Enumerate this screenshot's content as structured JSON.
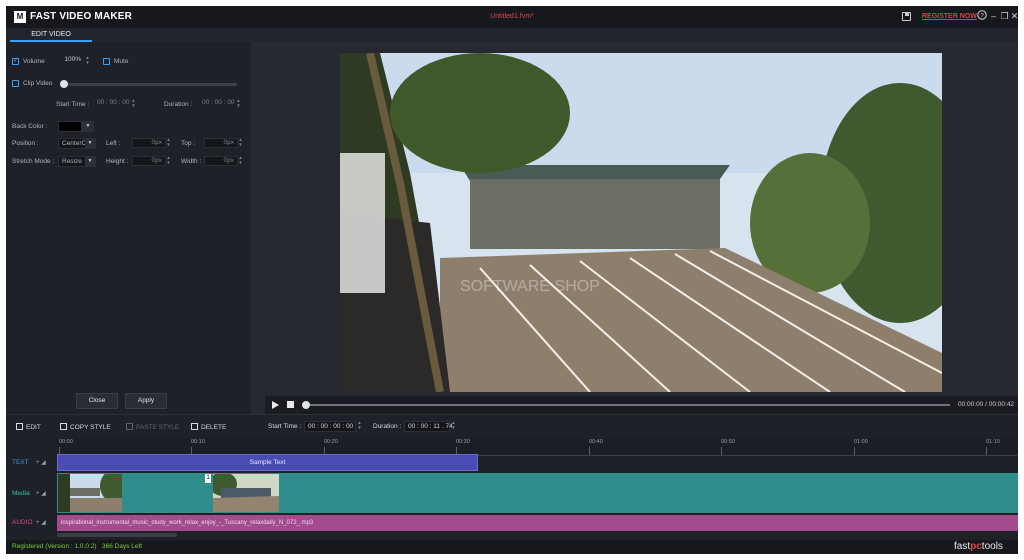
{
  "window": {
    "app_title": "FAST VIDEO MAKER",
    "logo_text": "M",
    "doc_title": "Untitled1.fvm*",
    "register_link": "REGISTER NOW",
    "help_icon": "help-icon",
    "controls": [
      "–",
      "❐",
      "✕"
    ]
  },
  "tabs": {
    "edit_video": "EDIT VIDEO"
  },
  "panel": {
    "volume_label": "Volume",
    "volume_value": "100%",
    "volume_checked": true,
    "mute_label": "Mute",
    "mute_checked": false,
    "clip_video_label": "Clip Video",
    "clip_video_checked": false,
    "start_time_label": "Start Time :",
    "start_time_value": "00 : 00 : 00",
    "duration_label": "Duration :",
    "duration_value": "00 : 00 : 00",
    "back_color_label": "Back Color :",
    "back_color": "#000000",
    "position_label": "Position :",
    "position_value": "CenterCe",
    "left_label": "Left :",
    "left_value": "0px",
    "top_label": "Top :",
    "top_value": "0px",
    "stretch_label": "Stretch Mode :",
    "stretch_value": "Resize",
    "height_label": "Height :",
    "height_value": "0px",
    "width_label": "Width :",
    "width_value": "0px",
    "close_button": "Close",
    "apply_button": "Apply"
  },
  "player": {
    "watermark": "SOFTWARE SHOP",
    "current_time": "00:00:00",
    "separator": "/",
    "total_time": "00:00:42",
    "progress": 0
  },
  "toolbar": {
    "edit": "EDIT",
    "copy_style": "COPY STYLE",
    "paste_style": "PASTE STYLE",
    "delete": "DELETE",
    "start_time_label": "Start Time :",
    "start_time_value": "00 : 00 : 00 : 00",
    "duration_label": "Duration :",
    "duration_value": "00 : 00 : 11 . 74"
  },
  "timeline": {
    "ruler": [
      "00:00",
      "00:10",
      "00:20",
      "00:30",
      "00:40",
      "00:50",
      "01:00",
      "01:10"
    ],
    "tracks": {
      "text": {
        "label": "TEXT",
        "color": "#3a8fd8"
      },
      "media": {
        "label": "Media",
        "color": "#3fbf9f"
      },
      "audio": {
        "label": "AUDIO",
        "color": "#e0418e"
      }
    },
    "text_clip": "Sample Text",
    "media_badge": "1",
    "audio_clip": "inspirational_instrumental_music_study_work_relax_enjoy_-_Tuscany_relaxdaily_N_072_.mp3"
  },
  "status": {
    "registered": "Registered (Version : 1.0.0.2)",
    "days_left": "366 Days Left",
    "brand_prefix": "fast",
    "brand_mid": "pc",
    "brand_suffix": "tools"
  },
  "colors": {
    "accent": "#3aa0ff",
    "register": "#e0413a",
    "text_clip": "#4b4bb4",
    "media_track": "#2f8d8b",
    "audio_track": "#a24c8d",
    "status_green": "#7ecb3a"
  }
}
